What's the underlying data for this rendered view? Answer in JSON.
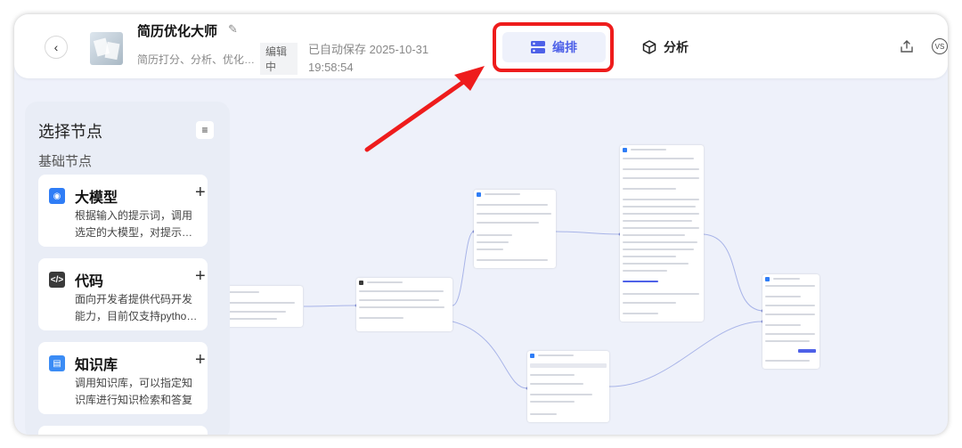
{
  "header": {
    "back_icon": "chevron-left-icon",
    "app_title": "简历优化大师",
    "app_subtitle": "简历打分、分析、优化…",
    "status_badge_line1": "编辑",
    "status_badge_line2": "中",
    "save_status_line1": "已自动保存 2025-10-31",
    "save_status_line2": "19:58:54",
    "tabs": [
      {
        "label": "编排",
        "icon": "workflow-icon",
        "active": true
      },
      {
        "label": "分析",
        "icon": "cube-icon",
        "active": false
      }
    ],
    "accent_color": "#4e61e8",
    "highlight_color": "#ee1c1c"
  },
  "sidebar": {
    "title": "选择节点",
    "section": "基础节点",
    "nodes": [
      {
        "name": "大模型",
        "desc": "根据输入的提示词，调用选定的大模型，对提示…",
        "icon": "llm-icon",
        "color": "#2f7df6"
      },
      {
        "name": "代码",
        "desc": "面向开发者提供代码开发能力，目前仅支持pytho…",
        "icon": "code-icon",
        "color": "#3a3a3a"
      },
      {
        "name": "知识库",
        "desc": "调用知识库，可以指定知识库进行知识检索和答复",
        "icon": "knowledge-icon",
        "color": "#3b8cf5"
      }
    ]
  }
}
